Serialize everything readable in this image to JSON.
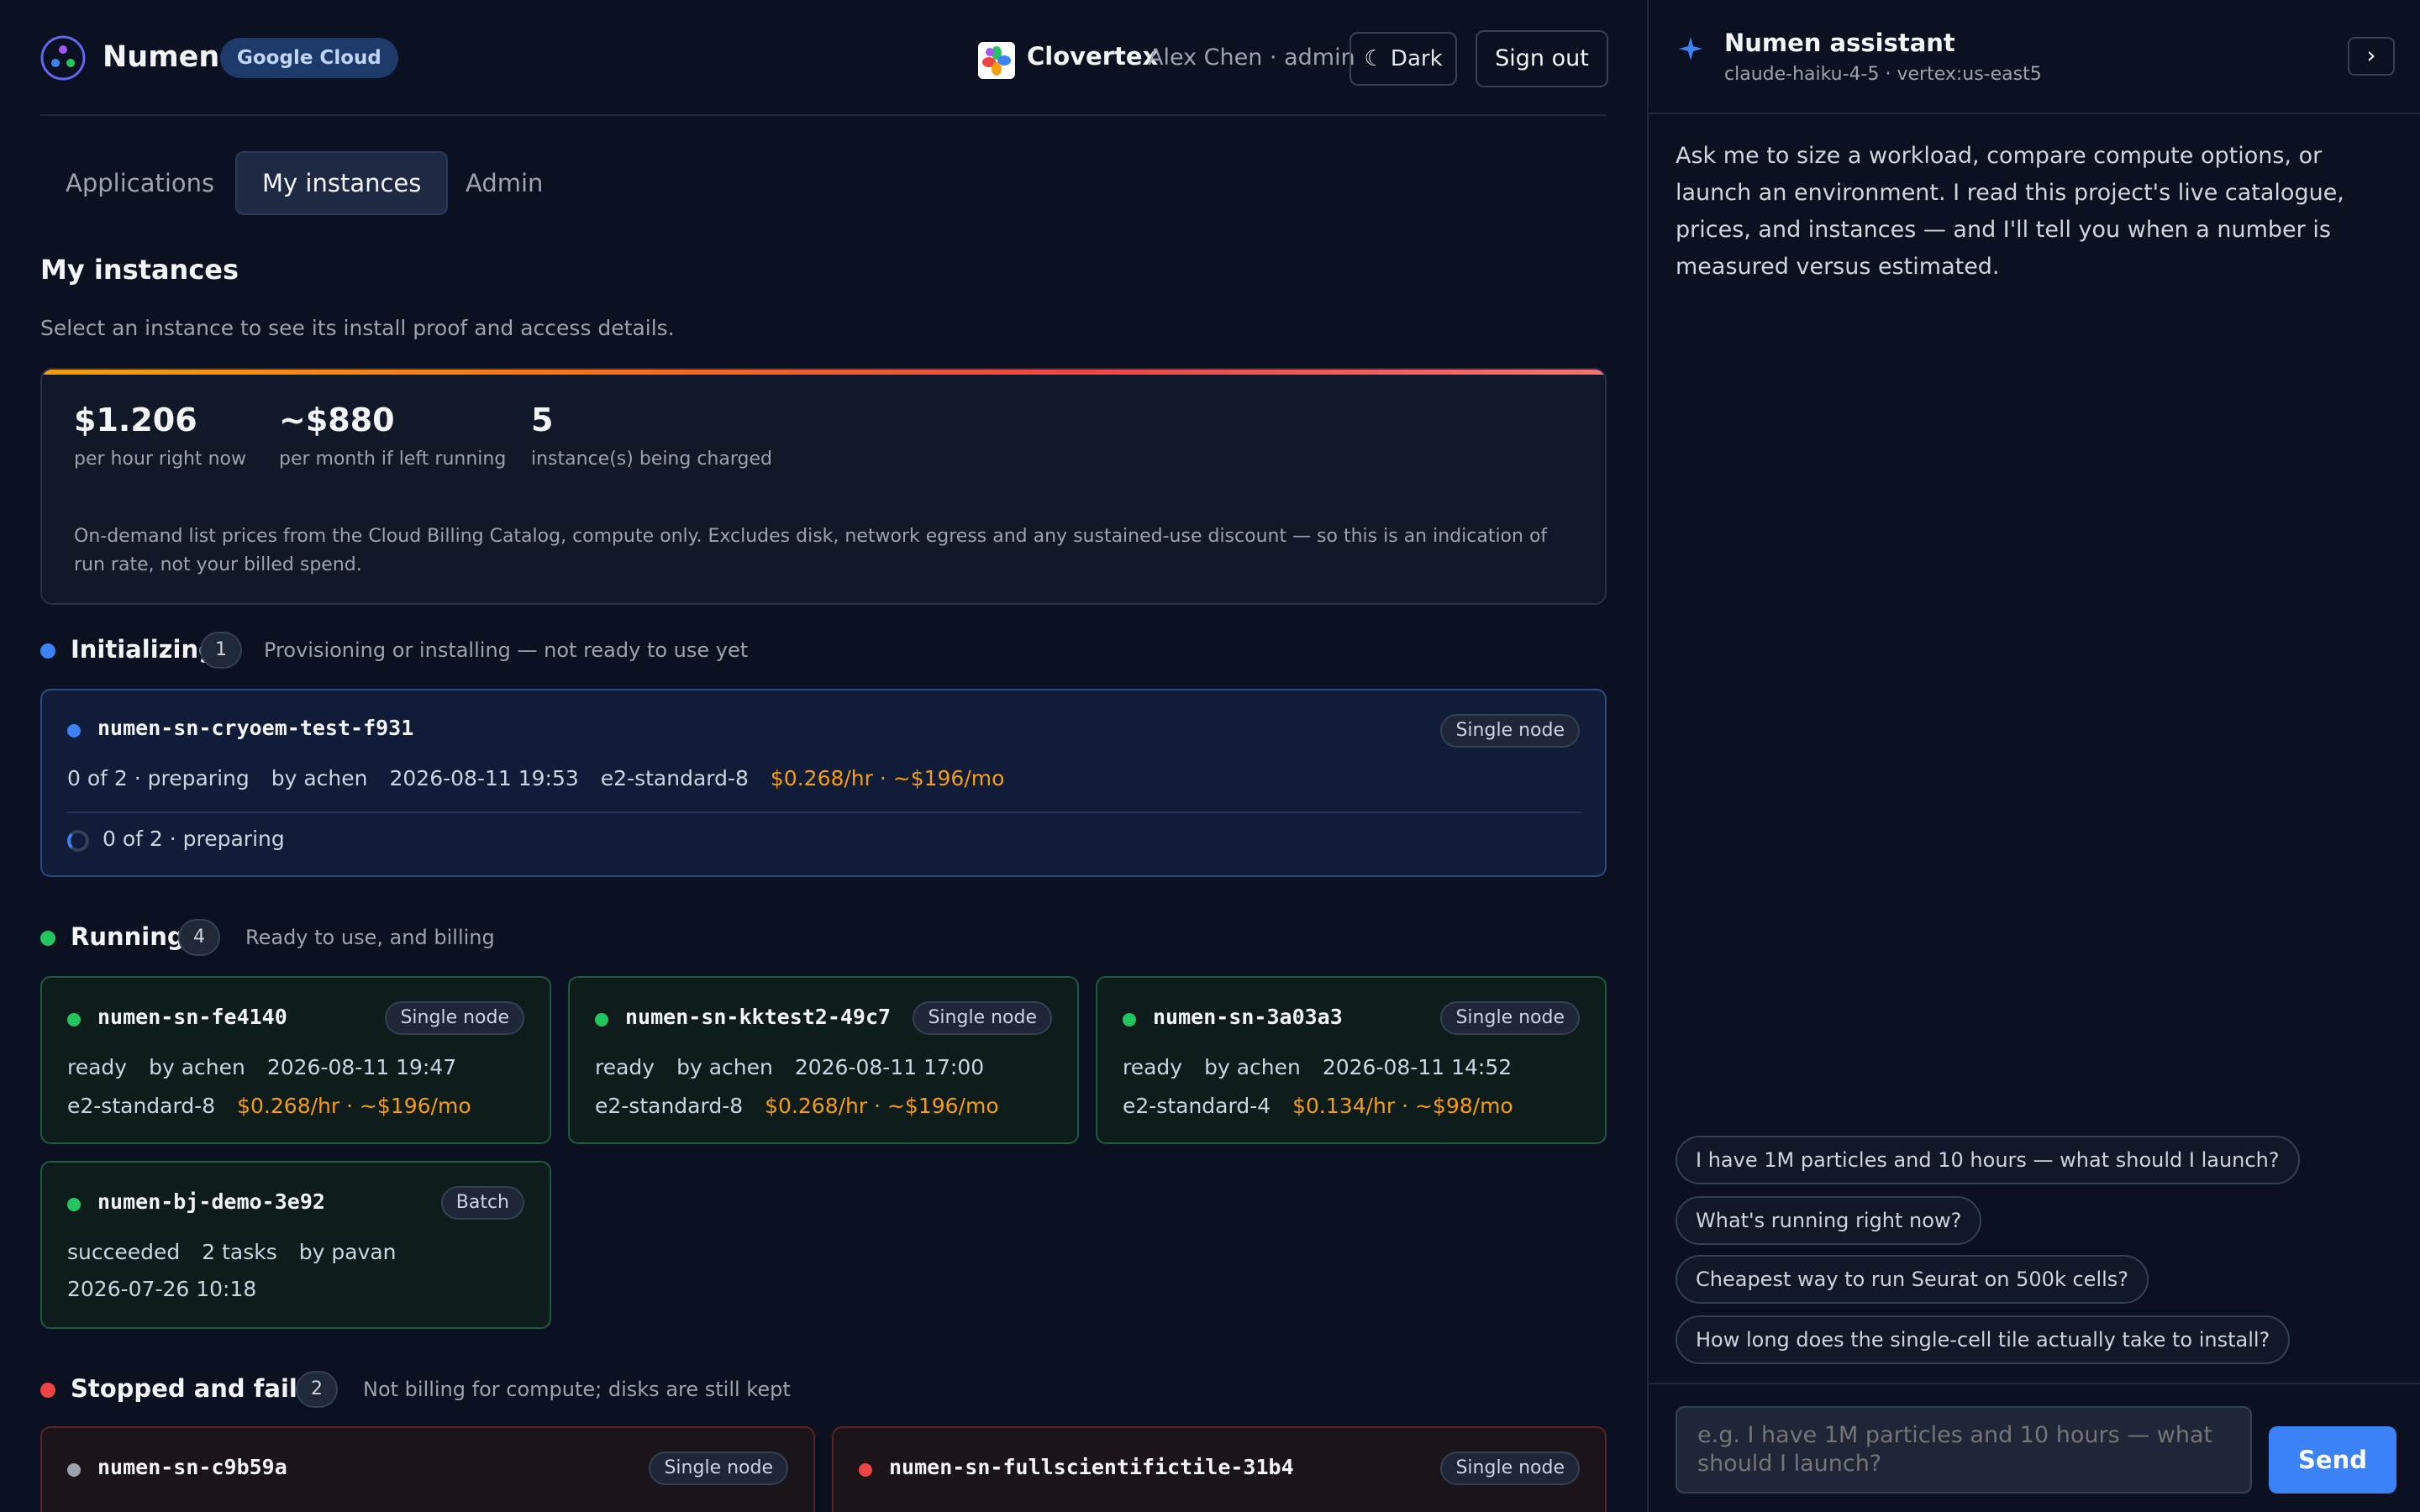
{
  "header": {
    "brand": "Numen",
    "cloud_badge": "Google Cloud",
    "org_name": "Clovertex",
    "user_info": "Alex Chen · admin",
    "theme_label": "☾ Dark",
    "signout_label": "Sign out"
  },
  "tabs": [
    {
      "label": "Applications"
    },
    {
      "label": "My instances"
    },
    {
      "label": "Admin"
    }
  ],
  "page": {
    "title": "My instances",
    "subtitle": "Select an instance to see its install proof and access details."
  },
  "cost": {
    "hourly": "$1.206",
    "hourly_label": "per hour right now",
    "monthly": "~$880",
    "monthly_label": "per month if left running",
    "count": "5",
    "count_label": "instance(s) being charged",
    "note": "On-demand list prices from the Cloud Billing Catalog, compute only. Excludes disk, network egress and any sustained-use discount — so this is an indication of run rate, not your billed spend."
  },
  "sections": {
    "initializing": {
      "title": "Initializing",
      "count": "1",
      "desc": "Provisioning or installing — not ready to use yet",
      "color": "#3b82f6"
    },
    "running": {
      "title": "Running",
      "count": "4",
      "desc": "Ready to use, and billing",
      "color": "#22c55e"
    },
    "stopped": {
      "title": "Stopped and failed",
      "count": "2",
      "desc": "Not billing for compute; disks are still kept",
      "color": "#ef4444"
    }
  },
  "init_card": {
    "name": "numen-sn-cryoem-test-f931",
    "badge": "Single node",
    "status": "0 of 2 · preparing",
    "owner": "by achen",
    "time": "2026-08-11 19:53",
    "machine": "e2-standard-8",
    "price": "$0.268/hr · ~$196/mo",
    "progress": "0 of 2 · preparing"
  },
  "running_cards": [
    {
      "name": "numen-sn-fe4140",
      "badge": "Single node",
      "status": "ready",
      "owner": "by achen",
      "time": "2026-08-11 19:47",
      "machine": "e2-standard-8",
      "price": "$0.268/hr · ~$196/mo"
    },
    {
      "name": "numen-sn-kktest2-49c7",
      "badge": "Single node",
      "status": "ready",
      "owner": "by achen",
      "time": "2026-08-11 17:00",
      "machine": "e2-standard-8",
      "price": "$0.268/hr · ~$196/mo"
    },
    {
      "name": "numen-sn-3a03a3",
      "badge": "Single node",
      "status": "ready",
      "owner": "by achen",
      "time": "2026-08-11 14:52",
      "machine": "e2-standard-4",
      "price": "$0.134/hr · ~$98/mo"
    }
  ],
  "batch_card": {
    "name": "numen-bj-demo-3e92",
    "badge": "Batch",
    "status": "succeeded",
    "tasks": "2 tasks",
    "owner": "by pavan",
    "time": "2026-07-26 10:18"
  },
  "stopped_cards": [
    {
      "name": "numen-sn-c9b59a",
      "badge": "Single node"
    },
    {
      "name": "numen-sn-fullscientifictile-31b4",
      "badge": "Single node"
    }
  ],
  "assistant": {
    "title": "Numen assistant",
    "model": "claude-haiku-4-5 · vertex:us-east5",
    "collapse_label": "›",
    "intro": "Ask me to size a workload, compare compute options, or launch an environment. I read this project's live catalogue, prices, and instances — and I'll tell you when a number is measured versus estimated.",
    "suggestions": [
      "I have 1M particles and 10 hours — what should I launch?",
      "What's running right now?",
      "Cheapest way to run Seurat on 500k cells?",
      "How long does the single-cell tile actually take to install?"
    ],
    "input_placeholder": "e.g. I have 1M particles and 10 hours — what should I launch?",
    "send_label": "Send"
  }
}
